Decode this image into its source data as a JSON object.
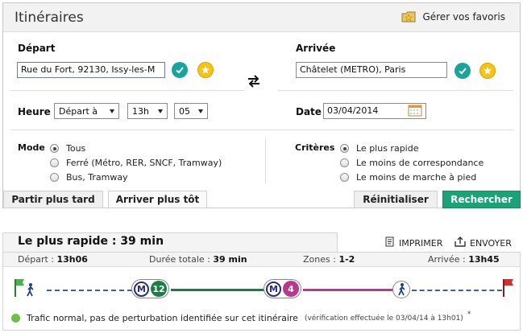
{
  "header": {
    "title": "Itinéraires",
    "favorites_label": "Gérer vos favoris"
  },
  "departure": {
    "label": "Départ",
    "value": "Rue du Fort, 92130, Issy-les-M"
  },
  "arrival": {
    "label": "Arrivée",
    "value": "Châtelet (METRO), Paris"
  },
  "time": {
    "label": "Heure",
    "mode_selected": "Départ à",
    "hour": "13h",
    "minute": "05"
  },
  "date": {
    "label": "Date",
    "value": "03/04/2014"
  },
  "mode": {
    "label": "Mode",
    "options": [
      {
        "label": "Tous",
        "selected": true
      },
      {
        "label": "Ferré (Métro, RER, SNCF, Tramway)",
        "selected": false
      },
      {
        "label": "Bus, Tramway",
        "selected": false
      }
    ]
  },
  "criteria": {
    "label": "Critères",
    "options": [
      {
        "label": "Le plus rapide",
        "selected": true
      },
      {
        "label": "Le moins de correspondance",
        "selected": false
      },
      {
        "label": "Le moins de marche à pied",
        "selected": false
      }
    ]
  },
  "buttons": {
    "later": "Partir plus tard",
    "earlier": "Arriver plus tôt",
    "reset": "Réinitialiser",
    "search": "Rechercher"
  },
  "result": {
    "title": "Le plus rapide : 39 min",
    "print": "IMPRIMER",
    "send": "ENVOYER",
    "depart_label": "Départ :",
    "depart_value": "13h06",
    "duration_label": "Durée totale :",
    "duration_value": "39 min",
    "zones_label": "Zones :",
    "zones_value": "1-2",
    "arrival_label": "Arrivée :",
    "arrival_value": "13h45",
    "legs": [
      {
        "type": "metro",
        "letter": "M",
        "line": "12",
        "color": "#1a7e45"
      },
      {
        "type": "metro",
        "letter": "M",
        "line": "4",
        "color": "#b8378f"
      }
    ],
    "traffic_main": "Trafic normal, pas de perturbation identifiée sur cet itinéraire",
    "traffic_note": "(vérification effectuée le 03/04/14 à 13h01)",
    "asterisk": "*"
  },
  "colors": {
    "accent_green": "#1ba377",
    "metro_blue": "#2a2d7c",
    "walk_dash": "#3b5fa0"
  }
}
